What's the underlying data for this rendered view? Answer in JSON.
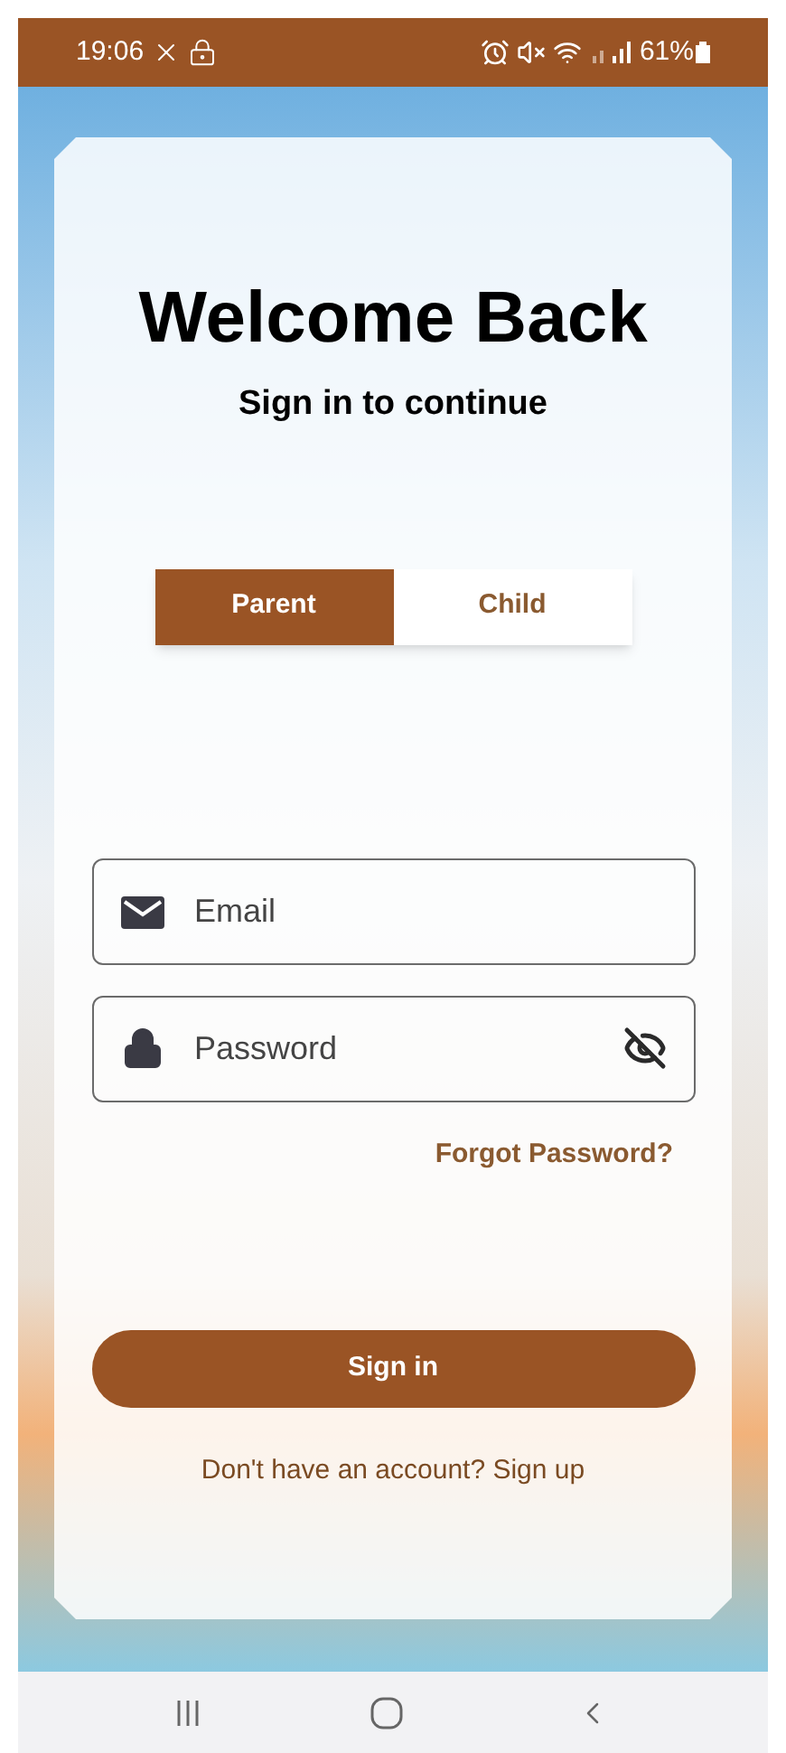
{
  "status_bar": {
    "time": "19:06",
    "battery": "61%"
  },
  "header": {
    "title": "Welcome Back",
    "subtitle": "Sign in to continue"
  },
  "tabs": [
    {
      "label": "Parent",
      "selected": true
    },
    {
      "label": "Child",
      "selected": false
    }
  ],
  "email": {
    "placeholder": "Email"
  },
  "password": {
    "placeholder": "Password"
  },
  "forgot_link": "Forgot Password?",
  "sign_in_button": "Sign in",
  "sign_up_prompt": "Don't have an account? Sign up"
}
